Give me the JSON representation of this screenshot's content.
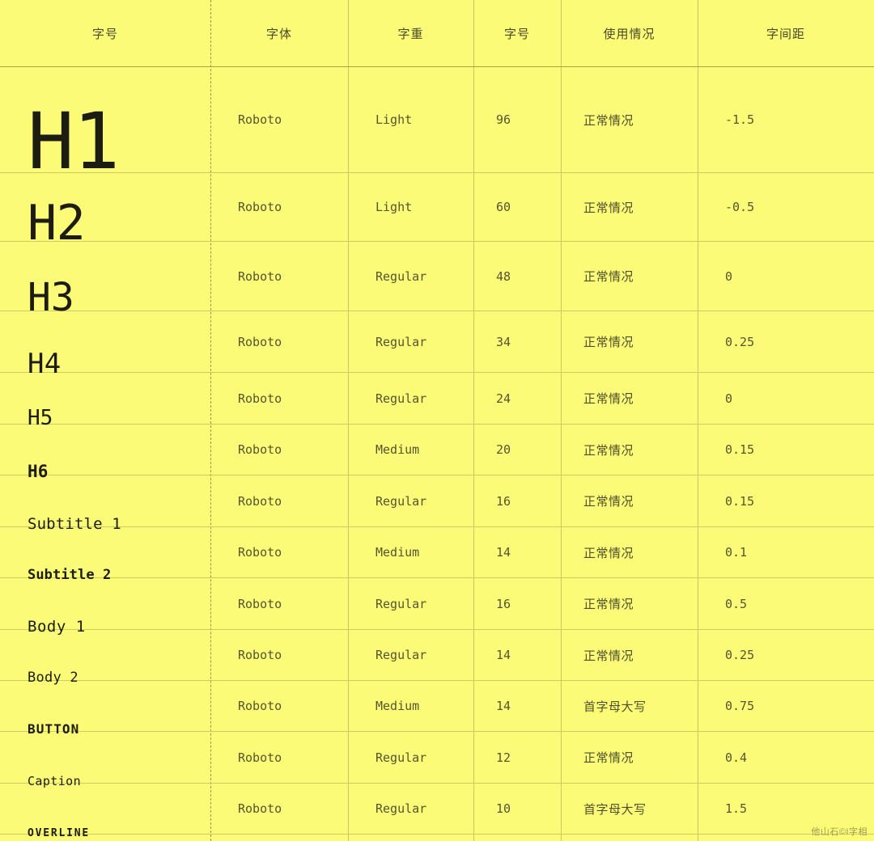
{
  "table": {
    "headers": [
      {
        "label": "字号",
        "key": "style_name"
      },
      {
        "label": "字体",
        "key": "font"
      },
      {
        "label": "字重",
        "key": "weight"
      },
      {
        "label": "字号",
        "key": "size"
      },
      {
        "label": "使用情况",
        "key": "usage"
      },
      {
        "label": "字间距",
        "key": "letter_spacing"
      }
    ],
    "rows": [
      {
        "sample": "H1",
        "font": "Roboto",
        "weight": "Light",
        "size": "96",
        "usage": "正常情况",
        "letter_spacing": "-1.5"
      },
      {
        "sample": "H2",
        "font": "Roboto",
        "weight": "Light",
        "size": "60",
        "usage": "正常情况",
        "letter_spacing": "-0.5"
      },
      {
        "sample": "H3",
        "font": "Roboto",
        "weight": "Regular",
        "size": "48",
        "usage": "正常情况",
        "letter_spacing": "0"
      },
      {
        "sample": "H4",
        "font": "Roboto",
        "weight": "Regular",
        "size": "34",
        "usage": "正常情况",
        "letter_spacing": "0.25"
      },
      {
        "sample": "H5",
        "font": "Roboto",
        "weight": "Regular",
        "size": "24",
        "usage": "正常情况",
        "letter_spacing": "0"
      },
      {
        "sample": "H6",
        "font": "Roboto",
        "weight": "Medium",
        "size": "20",
        "usage": "正常情况",
        "letter_spacing": "0.15"
      },
      {
        "sample": "Subtitle 1",
        "font": "Roboto",
        "weight": "Regular",
        "size": "16",
        "usage": "正常情况",
        "letter_spacing": "0.15"
      },
      {
        "sample": "Subtitle 2",
        "font": "Roboto",
        "weight": "Medium",
        "size": "14",
        "usage": "正常情况",
        "letter_spacing": "0.1"
      },
      {
        "sample": "Body 1",
        "font": "Roboto",
        "weight": "Regular",
        "size": "16",
        "usage": "正常情况",
        "letter_spacing": "0.5"
      },
      {
        "sample": "Body 2",
        "font": "Roboto",
        "weight": "Regular",
        "size": "14",
        "usage": "正常情况",
        "letter_spacing": "0.25"
      },
      {
        "sample": "BUTTON",
        "font": "Roboto",
        "weight": "Medium",
        "size": "14",
        "usage": "首字母大写",
        "letter_spacing": "0.75"
      },
      {
        "sample": "Caption",
        "font": "Roboto",
        "weight": "Regular",
        "size": "12",
        "usage": "正常情况",
        "letter_spacing": "0.4"
      },
      {
        "sample": "OVERLINE",
        "font": "Roboto",
        "weight": "Regular",
        "size": "10",
        "usage": "首字母大写",
        "letter_spacing": "1.5"
      }
    ]
  },
  "watermark": {
    "text": "他山石©I字相"
  },
  "colors": {
    "background": "#fbfb78",
    "header_text": "#4a4a2a",
    "body_text": "#55552e",
    "sample_text": "#1c1c10",
    "row_rule": "#cccc63",
    "header_rule": "#a3a348",
    "dashed_rule": "#9a9a46"
  }
}
